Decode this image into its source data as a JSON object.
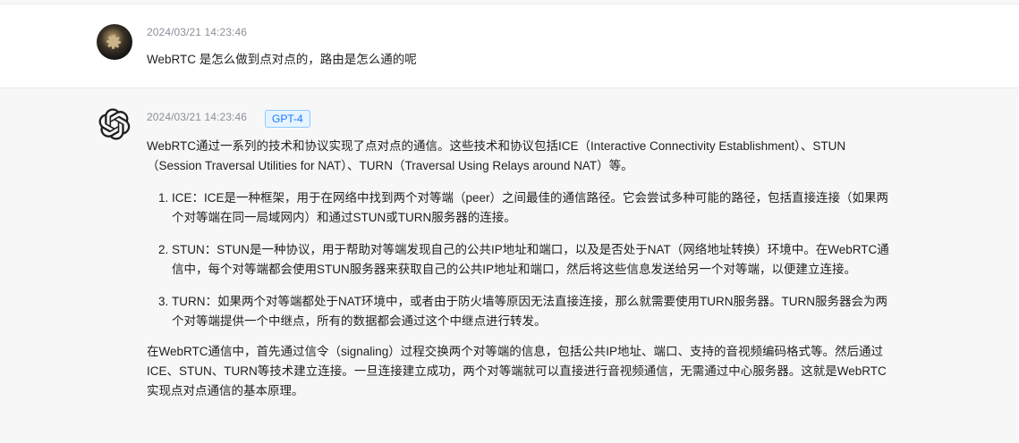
{
  "user_message": {
    "timestamp": "2024/03/21 14:23:46",
    "text": "WebRTC 是怎么做到点对点的，路由是怎么通的呢"
  },
  "assistant_message": {
    "timestamp": "2024/03/21 14:23:46",
    "model_badge": "GPT-4",
    "intro": "WebRTC通过一系列的技术和协议实现了点对点的通信。这些技术和协议包括ICE（Interactive Connectivity Establishment）、STUN（Session Traversal Utilities for NAT）、TURN（Traversal Using Relays around NAT）等。",
    "list": [
      "ICE：ICE是一种框架，用于在网络中找到两个对等端（peer）之间最佳的通信路径。它会尝试多种可能的路径，包括直接连接（如果两个对等端在同一局域网内）和通过STUN或TURN服务器的连接。",
      "STUN：STUN是一种协议，用于帮助对等端发现自己的公共IP地址和端口，以及是否处于NAT（网络地址转换）环境中。在WebRTC通信中，每个对等端都会使用STUN服务器来获取自己的公共IP地址和端口，然后将这些信息发送给另一个对等端，以便建立连接。",
      "TURN：如果两个对等端都处于NAT环境中，或者由于防火墙等原因无法直接连接，那么就需要使用TURN服务器。TURN服务器会为两个对等端提供一个中继点，所有的数据都会通过这个中继点进行转发。"
    ],
    "conclusion": "在WebRTC通信中，首先通过信令（signaling）过程交换两个对等端的信息，包括公共IP地址、端口、支持的音视频编码格式等。然后通过ICE、STUN、TURN等技术建立连接。一旦连接建立成功，两个对等端就可以直接进行音视频通信，无需通过中心服务器。这就是WebRTC实现点对点通信的基本原理。"
  },
  "colors": {
    "badge_text": "#1677ff",
    "badge_bg": "#e6f4ff",
    "assistant_bg": "#f7f7f8"
  },
  "icons": {
    "user_avatar": "avatar",
    "assistant_avatar": "openai-logo-icon"
  }
}
